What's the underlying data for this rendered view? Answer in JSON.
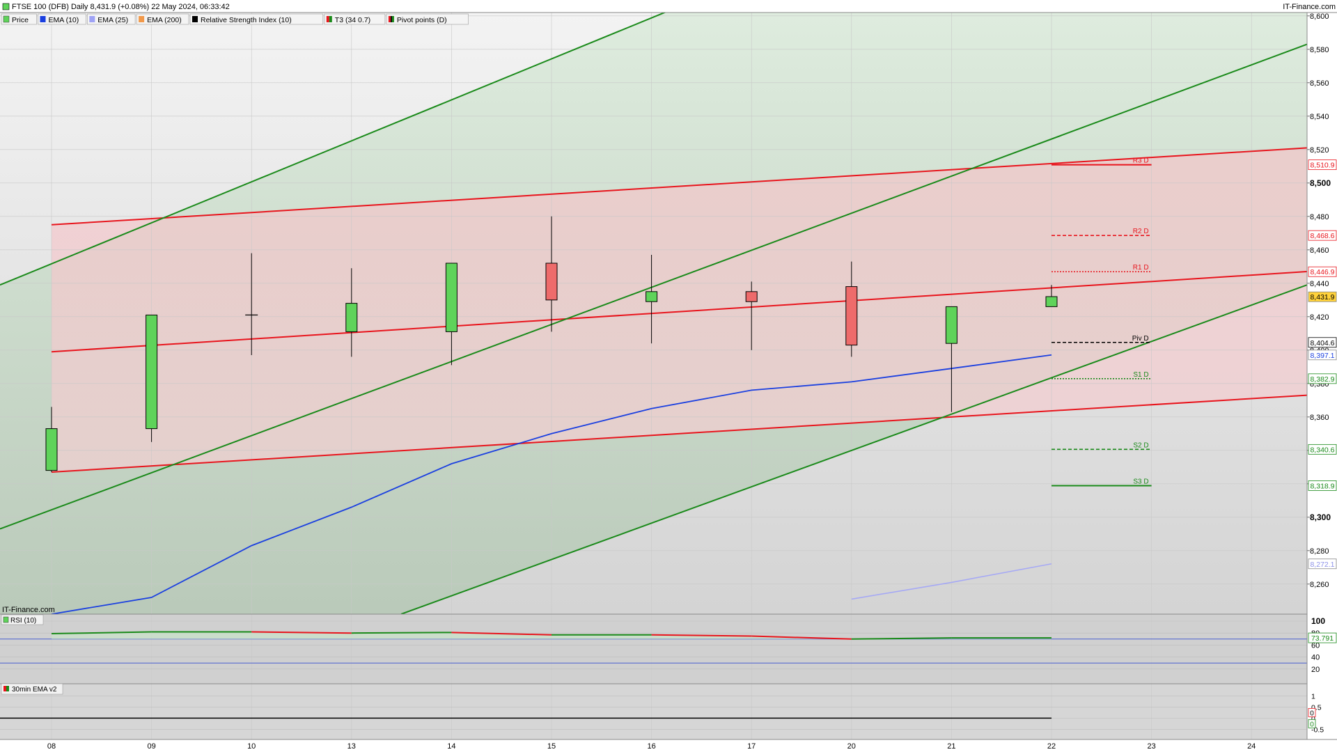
{
  "header": {
    "title": "FTSE 100 (DFB) Daily 8,431.9 (+0.08%) 22 May 2024, 06:33:42",
    "brand": "IT-Finance.com"
  },
  "watermark": "IT-Finance.com",
  "legend": [
    {
      "label": "Price",
      "swatch": "candle"
    },
    {
      "label": "EMA (10)",
      "color": "#1a3fe0"
    },
    {
      "label": "EMA (25)",
      "color": "#9fa3f5"
    },
    {
      "label": "EMA (200)",
      "color": "#f2994a"
    },
    {
      "label": "Relative Strength Index (10)",
      "color": "#000000"
    },
    {
      "label": "T3 (34 0.7)",
      "swatch": "t3"
    },
    {
      "label": "Pivot points (D)",
      "swatch": "pivot"
    }
  ],
  "colors": {
    "up": "#5fd35a",
    "down": "#ee6b6b",
    "ema10": "#1a3fe0",
    "ema25": "#a6a9f5",
    "channel_red": "#e8141c",
    "channel_green": "#1a8a1a",
    "resistance": "#e8141c",
    "support": "#1a8a1a",
    "pivot": "#000000",
    "grid": "#c8c8c8"
  },
  "chart_data": [
    {
      "type": "candlestick",
      "title": "FTSE 100 (DFB) Daily",
      "x_ticks": [
        "08",
        "09",
        "10",
        "13",
        "14",
        "15",
        "16",
        "17",
        "20",
        "21",
        "22",
        "23",
        "24"
      ],
      "y_ticks": [
        "8,260",
        "8,280",
        "8,300",
        "8,320",
        "8,340",
        "8,360",
        "8,380",
        "8,400",
        "8,420",
        "8,440",
        "8,460",
        "8,480",
        "8,500",
        "8,520",
        "8,540",
        "8,560",
        "8,580",
        "8,600"
      ],
      "ylim": [
        8242,
        8602
      ],
      "candles": [
        {
          "date": "08",
          "open": 8328,
          "high": 8366,
          "low": 8327,
          "close": 8353
        },
        {
          "date": "09",
          "open": 8353,
          "high": 8421,
          "low": 8345,
          "close": 8421
        },
        {
          "date": "10",
          "open": 8421,
          "high": 8458,
          "low": 8397,
          "close": 8421
        },
        {
          "date": "13",
          "open": 8411,
          "high": 8449,
          "low": 8396,
          "close": 8428
        },
        {
          "date": "14",
          "open": 8411,
          "high": 8452,
          "low": 8391,
          "close": 8452
        },
        {
          "date": "15",
          "open": 8452,
          "high": 8480,
          "low": 8411,
          "close": 8430
        },
        {
          "date": "16",
          "open": 8429,
          "high": 8457,
          "low": 8404,
          "close": 8435
        },
        {
          "date": "17",
          "open": 8435,
          "high": 8441,
          "low": 8400,
          "close": 8429
        },
        {
          "date": "20",
          "open": 8438,
          "high": 8453,
          "low": 8396,
          "close": 8403
        },
        {
          "date": "21",
          "open": 8404,
          "high": 8426,
          "low": 8363,
          "close": 8426
        },
        {
          "date": "22",
          "open": 8426,
          "high": 8439,
          "low": 8426,
          "close": 8432
        }
      ],
      "ema10": {
        "name": "EMA (10)",
        "points": [
          [
            "08",
            8242
          ],
          [
            "09",
            8252
          ],
          [
            "10",
            8283
          ],
          [
            "13",
            8306
          ],
          [
            "14",
            8332
          ],
          [
            "15",
            8350
          ],
          [
            "16",
            8365
          ],
          [
            "17",
            8376
          ],
          [
            "20",
            8381
          ],
          [
            "21",
            8389
          ],
          [
            "22",
            8397.1
          ]
        ]
      },
      "ema25": {
        "name": "EMA (25)",
        "points": [
          [
            "20",
            8251
          ],
          [
            "21",
            8261
          ],
          [
            "22",
            8272.1
          ]
        ]
      },
      "pivots": [
        {
          "label": "R3 D",
          "value": 8510.9,
          "value_label": "8,510.9",
          "style": "solid",
          "color": "#e8141c"
        },
        {
          "label": "R2 D",
          "value": 8468.6,
          "value_label": "8,468.6",
          "style": "dashed",
          "color": "#e8141c"
        },
        {
          "label": "R1 D",
          "value": 8446.9,
          "value_label": "8,446.9",
          "style": "dotted",
          "color": "#e8141c"
        },
        {
          "label": "Piv D",
          "value": 8404.6,
          "value_label": "8,404.6",
          "style": "dashed",
          "color": "#000000"
        },
        {
          "label": "S1 D",
          "value": 8382.9,
          "value_label": "8,382.9",
          "style": "dotted",
          "color": "#1a8a1a"
        },
        {
          "label": "S2 D",
          "value": 8340.6,
          "value_label": "8,340.6",
          "style": "dashed",
          "color": "#1a8a1a"
        },
        {
          "label": "S3 D",
          "value": 8318.9,
          "value_label": "8,318.9",
          "style": "solid",
          "color": "#1a8a1a"
        }
      ],
      "price_markers": [
        {
          "value": 8431.9,
          "label": "8,431.9",
          "fill": "#ffd23a",
          "text": "#000000"
        },
        {
          "value": 8397.1,
          "label": "8,397.1",
          "fill": "#ffffff",
          "text": "#1a3fe0"
        },
        {
          "value": 8272.1,
          "label": "8,272.1",
          "fill": "#ffffff",
          "text": "#8c90e8"
        }
      ],
      "channels": {
        "red_upper": [
          [
            "08",
            8475
          ],
          [
            "24+",
            8521
          ]
        ],
        "red_mid": [
          [
            "08",
            8399
          ],
          [
            "24+",
            8447
          ]
        ],
        "red_lower": [
          [
            "08",
            8327
          ],
          [
            "24+",
            8373
          ]
        ],
        "green_upper": [
          [
            "start",
            8439
          ],
          [
            "17+",
            8618
          ]
        ],
        "green_mid": [
          [
            "start",
            8293
          ],
          [
            "24+",
            8583
          ]
        ],
        "green_lower": [
          [
            "13+",
            8242
          ],
          [
            "24+",
            8439
          ]
        ]
      }
    },
    {
      "type": "line",
      "title": "RSI (10)",
      "y_ticks": [
        "100",
        "80",
        "60",
        "40",
        "20"
      ],
      "ylim": [
        0,
        100
      ],
      "levels": [
        70,
        30
      ],
      "current_label": "73.791",
      "series": [
        {
          "name": "RSI (10)",
          "points": [
            [
              "08",
              79
            ],
            [
              "09",
              82
            ],
            [
              "10",
              82
            ],
            [
              "13",
              80
            ],
            [
              "14",
              81
            ],
            [
              "15",
              77
            ],
            [
              "16",
              77
            ],
            [
              "17",
              75
            ],
            [
              "20",
              70
            ],
            [
              "21",
              72
            ],
            [
              "22",
              72
            ]
          ]
        }
      ]
    },
    {
      "type": "line",
      "title": "30min EMA v2",
      "y_ticks": [
        "1",
        "0.5",
        "0",
        "-0.5"
      ],
      "ylim": [
        -0.9,
        1.3
      ],
      "current_labels": [
        "0",
        "0"
      ],
      "series": [
        {
          "name": "30min EMA v2",
          "points": [
            [
              "08",
              0
            ],
            [
              "22",
              0
            ]
          ]
        }
      ]
    }
  ]
}
